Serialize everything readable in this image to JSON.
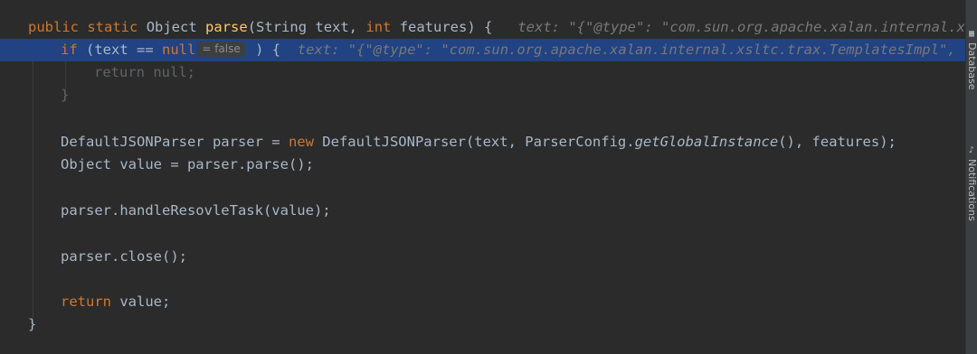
{
  "code": {
    "line1": {
      "kw_public": "public",
      "kw_static": "static",
      "type_object": "Object",
      "method_name": "parse",
      "params_open": "(String text, ",
      "kw_int": "int",
      "params_close": " features) {",
      "debug_hint": "text: \"{\"@type\": \"com.sun.org.apache.xalan.internal.xs"
    },
    "line2": {
      "kw_if": "if",
      "cond": " (text == ",
      "kw_null": "null",
      "inlay_value": "= false",
      "brace": " ) {",
      "debug_hint": "text: \"{\"@type\": \"com.sun.org.apache.xalan.internal.xsltc.trax.TemplatesImpl\","
    },
    "line3": {
      "kw_return": "return",
      "rest": " null;"
    },
    "line4": {
      "text": "}"
    },
    "line6": {
      "start": "DefaultJSONParser parser = ",
      "kw_new": "new",
      "mid": " DefaultJSONParser(text, ParserConfig.",
      "italic_call": "getGlobalInstance",
      "end": "(), features);"
    },
    "line7": {
      "text": "Object value = parser.parse();"
    },
    "line9": {
      "text": "parser.handleResovleTask(value);"
    },
    "line11": {
      "text": "parser.close();"
    },
    "line13": {
      "kw_return": "return",
      "rest": " value;"
    },
    "line14": {
      "text": "}"
    }
  },
  "right_toolbar": {
    "database_label": "Database",
    "database_icon": "database-icon",
    "notifications_label": "Notifications",
    "notifications_icon": "bell-icon"
  },
  "colors": {
    "background": "#2b2b2b",
    "highlight": "#214283",
    "keyword": "#cc7832",
    "method": "#ffc66d",
    "text": "#a9b7c6",
    "hint": "#787878"
  }
}
